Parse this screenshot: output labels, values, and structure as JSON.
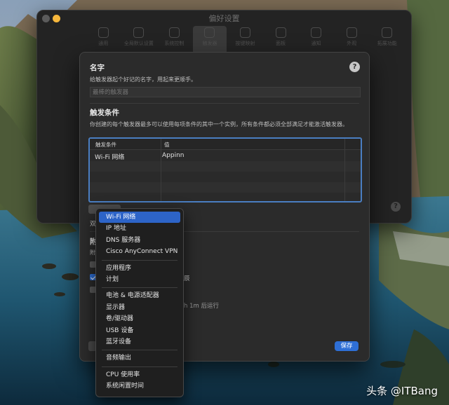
{
  "window": {
    "title": "偏好设置",
    "toolbar": [
      "通用",
      "全局默认设置",
      "系统控制",
      "触发器",
      "按键映射",
      "面板",
      "通知",
      "外观",
      "拓展功能"
    ]
  },
  "sheet": {
    "name_section": {
      "title": "名字",
      "description": "给触发器起个好记的名字，用起来更顺手。",
      "placeholder": "最棒的触发器"
    },
    "conditions_section": {
      "title": "触发条件",
      "description": "你创建的每个触发器最多可以使用每项条件的其中一个实例，所有条件都必须全部满足才能激活触发器。",
      "columns": [
        "触发条件",
        "值"
      ],
      "rows": [
        {
          "condition": "Wi-Fi 网络",
          "value": "Appinn"
        }
      ]
    },
    "partial_texts": {
      "double_click": "双",
      "section_head": "附",
      "section_desc": "附",
      "option_end": "辰",
      "delay_text": "h 1m 后运行"
    },
    "save_label": "保存",
    "help_label": "?"
  },
  "menu": {
    "groups": [
      [
        "Wi-Fi 网络",
        "IP 地址",
        "DNS 服务器",
        "Cisco AnyConnect VPN"
      ],
      [
        "应用程序",
        "计划"
      ],
      [
        "电池 & 电源适配器",
        "显示器",
        "卷/驱动器",
        "USB 设备",
        "蓝牙设备"
      ],
      [
        "音频输出"
      ],
      [
        "CPU 使用率",
        "系统闲置时间"
      ]
    ],
    "selected": "Wi-Fi 网络"
  },
  "watermark": "头条 @ITBang",
  "colors": {
    "accent": "#2e6fd6",
    "traffic_min": "#f6b73c"
  }
}
